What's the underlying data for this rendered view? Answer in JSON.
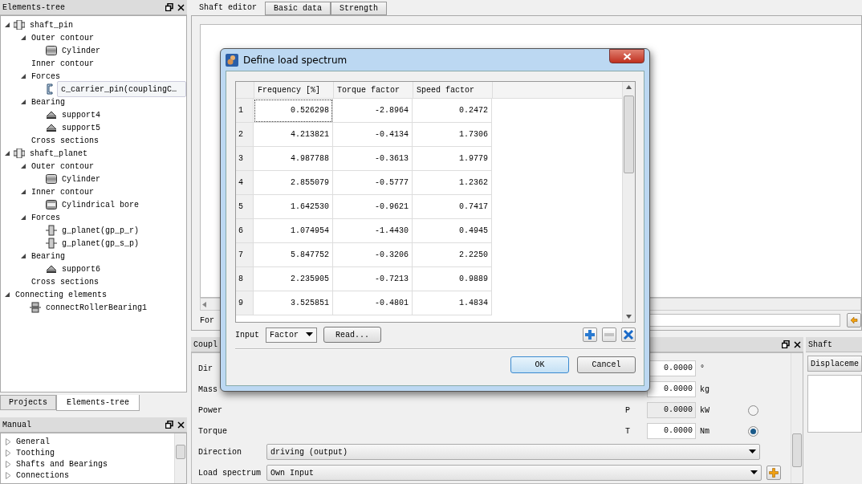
{
  "elements_tree": {
    "title": "Elements-tree",
    "items": [
      {
        "label": "shaft_pin",
        "kind": "shaft",
        "expanded": true,
        "selected": false,
        "children": [
          {
            "label": "Outer contour",
            "kind": "group",
            "expanded": true,
            "selected": false,
            "children": [
              {
                "label": "Cylinder",
                "kind": "cylinder",
                "selected": false
              }
            ]
          },
          {
            "label": "Inner contour",
            "kind": "group",
            "selected": false
          },
          {
            "label": "Forces",
            "kind": "group",
            "expanded": true,
            "selected": false,
            "children": [
              {
                "label": "c_carrier_pin(couplingC…",
                "kind": "coupling",
                "selected": true
              }
            ]
          },
          {
            "label": "Bearing",
            "kind": "group",
            "expanded": true,
            "selected": false,
            "children": [
              {
                "label": "support4",
                "kind": "bearing",
                "selected": false
              },
              {
                "label": "support5",
                "kind": "bearing",
                "selected": false
              }
            ]
          },
          {
            "label": "Cross sections",
            "kind": "group",
            "selected": false
          }
        ]
      },
      {
        "label": "shaft_planet",
        "kind": "shaft",
        "expanded": true,
        "selected": false,
        "children": [
          {
            "label": "Outer contour",
            "kind": "group",
            "expanded": true,
            "selected": false,
            "children": [
              {
                "label": "Cylinder",
                "kind": "cylinder",
                "selected": false
              }
            ]
          },
          {
            "label": "Inner contour",
            "kind": "group",
            "expanded": true,
            "selected": false,
            "children": [
              {
                "label": "Cylindrical bore",
                "kind": "bore",
                "selected": false
              }
            ]
          },
          {
            "label": "Forces",
            "kind": "group",
            "expanded": true,
            "selected": false,
            "children": [
              {
                "label": "g_planet(gp_p_r)",
                "kind": "gear",
                "selected": false
              },
              {
                "label": "g_planet(gp_s_p)",
                "kind": "gear",
                "selected": false
              }
            ]
          },
          {
            "label": "Bearing",
            "kind": "group",
            "expanded": true,
            "selected": false,
            "children": [
              {
                "label": "support6",
                "kind": "bearing",
                "selected": false
              }
            ]
          },
          {
            "label": "Cross sections",
            "kind": "group",
            "selected": false
          }
        ]
      },
      {
        "label": "Connecting elements",
        "kind": "group",
        "expanded": true,
        "selected": false,
        "children": [
          {
            "label": "connectRollerBearing1",
            "kind": "connector",
            "selected": false
          }
        ]
      }
    ]
  },
  "left_tabs": [
    {
      "label": "Projects",
      "selected": false
    },
    {
      "label": "Elements-tree",
      "selected": true
    }
  ],
  "manual": {
    "title": "Manual",
    "items": [
      {
        "label": "General",
        "expanded": false
      },
      {
        "label": "Toothing",
        "expanded": false
      },
      {
        "label": "Shafts and Bearings",
        "expanded": false
      },
      {
        "label": "Connections",
        "expanded": false
      }
    ]
  },
  "editor_tabs": [
    {
      "label": "Shaft editor",
      "selected": true
    },
    {
      "label": "Basic data",
      "selected": false
    },
    {
      "label": "Strength",
      "selected": false
    }
  ],
  "forces_row": {
    "label": "For"
  },
  "coupling_panel": {
    "title": "Coupl",
    "rows": [
      {
        "kind": "value",
        "label": "Dir",
        "value": "0.0000",
        "unit": "°"
      },
      {
        "kind": "value",
        "label": "Mass",
        "value": "0.0000",
        "unit": "kg"
      },
      {
        "kind": "radio",
        "label": "Power",
        "symbol": "P",
        "value": "0.0000",
        "unit": "kW",
        "selected": false
      },
      {
        "kind": "radio",
        "label": "Torque",
        "symbol": "T",
        "value": "0.0000",
        "unit": "Nm",
        "selected": true
      },
      {
        "kind": "select",
        "label": "Direction",
        "value": "driving (output)"
      },
      {
        "kind": "select_add",
        "label": "Load spectrum",
        "value": "Own Input"
      }
    ]
  },
  "shaft_panel": {
    "title": "Shaft",
    "button": "Displaceme"
  },
  "dialog": {
    "title": "Define load spectrum",
    "columns": [
      "Frequency [%]",
      "Torque factor",
      "Speed factor"
    ],
    "rows": [
      {
        "number": "1",
        "cells": [
          "0.526298",
          "-2.8964",
          "0.2472"
        ],
        "focused": true
      },
      {
        "number": "2",
        "cells": [
          "4.213821",
          "-0.4134",
          "1.7306"
        ],
        "focused": false
      },
      {
        "number": "3",
        "cells": [
          "4.987788",
          "-0.3613",
          "1.9779"
        ],
        "focused": false
      },
      {
        "number": "4",
        "cells": [
          "2.855079",
          "-0.5777",
          "1.2362"
        ],
        "focused": false
      },
      {
        "number": "5",
        "cells": [
          "1.642530",
          "-0.9621",
          "0.7417"
        ],
        "focused": false
      },
      {
        "number": "6",
        "cells": [
          "1.074954",
          "-1.4430",
          "0.4945"
        ],
        "focused": false
      },
      {
        "number": "7",
        "cells": [
          "5.847752",
          "-0.3206",
          "2.2250"
        ],
        "focused": false
      },
      {
        "number": "8",
        "cells": [
          "2.235905",
          "-0.7213",
          "0.9889"
        ],
        "focused": false
      },
      {
        "number": "9",
        "cells": [
          "3.525851",
          "-0.4801",
          "1.4834"
        ],
        "focused": false
      }
    ],
    "input_label": "Input",
    "input_select": "Factor",
    "read_button": "Read...",
    "tools": [
      {
        "kind": "add",
        "disabled": false
      },
      {
        "kind": "remove",
        "disabled": true
      },
      {
        "kind": "delete",
        "disabled": false
      }
    ],
    "ok": "OK",
    "cancel": "Cancel"
  }
}
